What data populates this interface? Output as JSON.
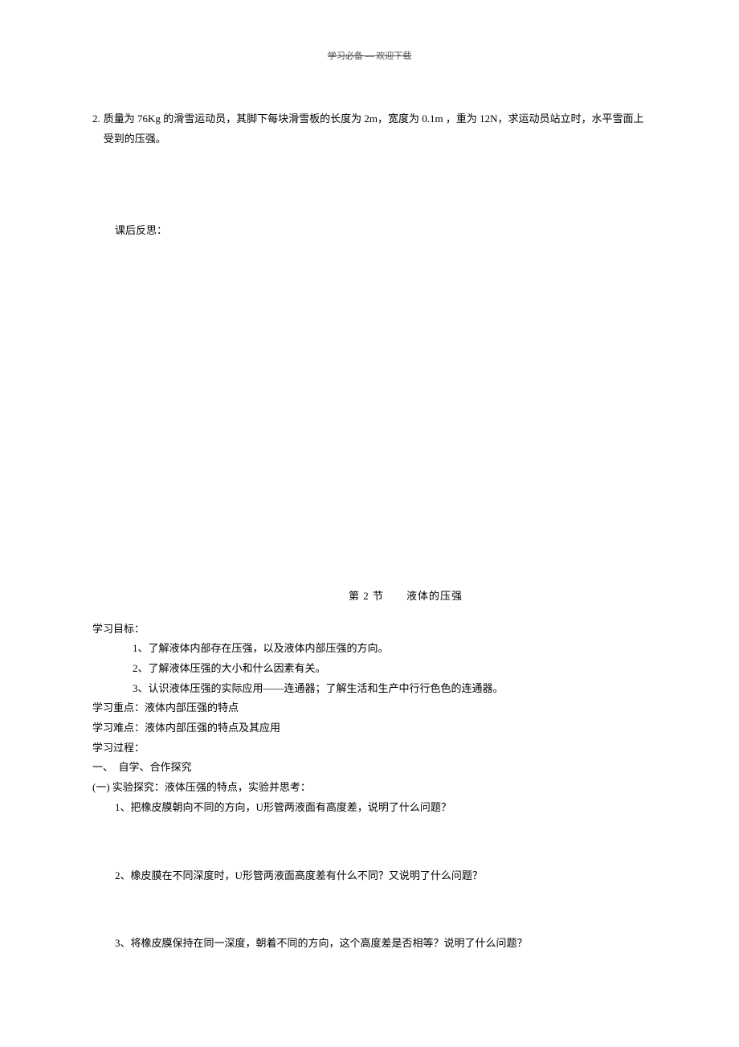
{
  "header": "学习必备 --- 欢迎下载",
  "problem2": {
    "num": "2.",
    "text": "质量为 76Kg 的滑雪运动员，其脚下每块滑雪板的长度为 2m，宽度为 0.1m ，重为 12N，求运动员站立时，水平雪面上受到的压强。"
  },
  "reflection": "课后反思：",
  "sectionTitle": "第 2 节　　液体的压强",
  "objectivesHeading": "学习目标：",
  "objectives": [
    "1、了解液体内部存在压强，以及液体内部压强的方向。",
    "2、了解液体压强的大小和什么因素有关。",
    "3、认识液体压强的实际应用——连通器；了解生活和生产中行行色色的连通器。"
  ],
  "focusLabel": "学习重点：液体内部压强的特点",
  "difficultLabel": "学习难点：液体内部压强的特点及其应用",
  "processLabel": "学习过程：",
  "step1": "一、　自学、合作探究",
  "exp": "(一) 实验探究：液体压强的特点，实验并思考：",
  "q1": "1、把橡皮膜朝向不同的方向，U形管两液面有高度差，说明了什么问题？",
  "q2": "2、橡皮膜在不同深度时，U形管两液面高度差有什么不同？又说明了什么问题？",
  "q3": "3、将橡皮膜保持在同一深度，朝着不同的方向，这个高度差是否相等？说明了什么问题？"
}
